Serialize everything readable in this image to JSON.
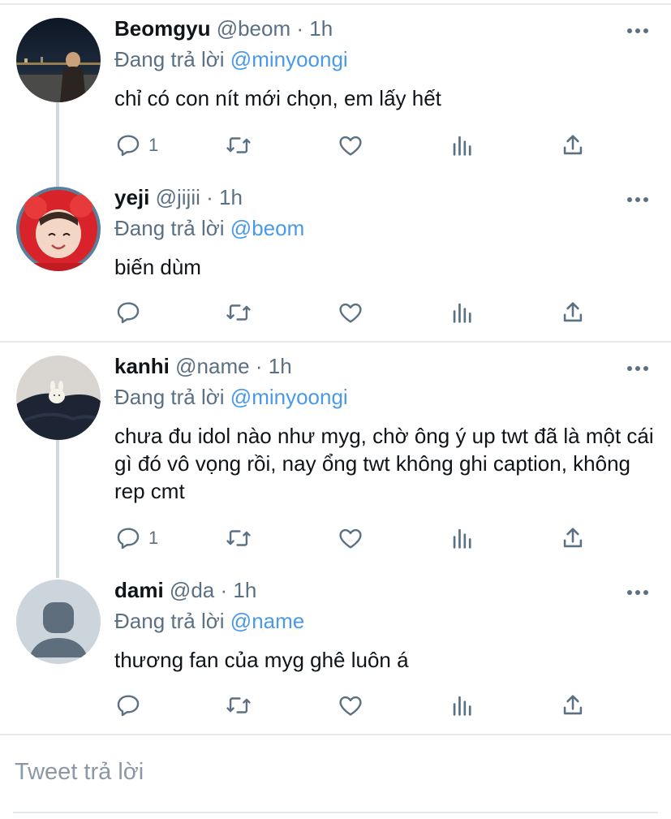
{
  "tweets": [
    {
      "name": "Beomgyu",
      "handle": "@beom",
      "dot": "·",
      "time": "1h",
      "reply_prefix": "Đang trả lời",
      "reply_to": "@minyoongi",
      "text": "chỉ có con nít mới chọn, em lấy hết",
      "reply_count": "1",
      "avatar_icon": "photo-night-city"
    },
    {
      "name": "yeji",
      "handle": "@jijii",
      "dot": "·",
      "time": "1h",
      "reply_prefix": "Đang trả lời",
      "reply_to": "@beom",
      "text": "biến dùm",
      "reply_count": "",
      "avatar_icon": "photo-red-hood"
    },
    {
      "name": "kanhi",
      "handle": "@name",
      "dot": "·",
      "time": "1h",
      "reply_prefix": "Đang trả lời",
      "reply_to": "@minyoongi",
      "text": "chưa đu idol nào như myg, chờ ông ý up twt đã là một cái gì đó vô vọng rồi,  nay ổng twt không ghi caption, không rep cmt",
      "reply_count": "1",
      "avatar_icon": "photo-bunny"
    },
    {
      "name": "dami",
      "handle": "@da",
      "dot": "·",
      "time": "1h",
      "reply_prefix": "Đang trả lời",
      "reply_to": "@name",
      "text": "thương fan của myg ghê luôn á",
      "reply_count": "",
      "avatar_icon": "default-avatar"
    }
  ],
  "compose": {
    "placeholder": "Tweet trả lời"
  },
  "colors": {
    "link": "#4a99e9",
    "muted": "#5b7083",
    "divider": "#e6e9ec",
    "thread": "#cfd9de"
  }
}
